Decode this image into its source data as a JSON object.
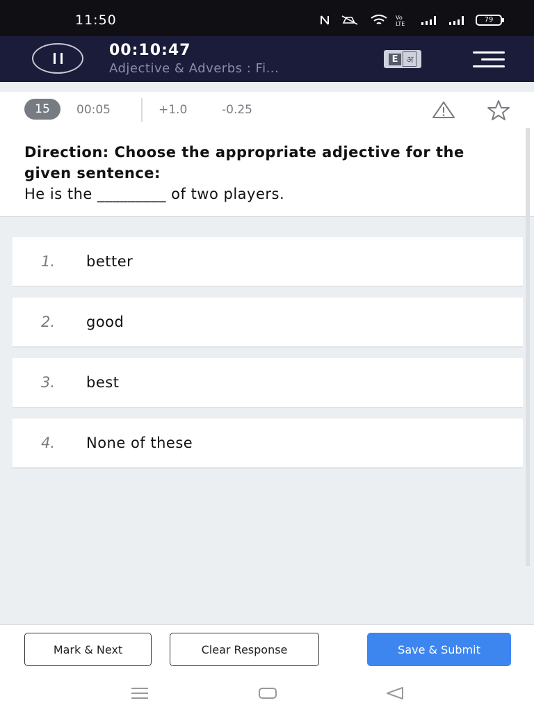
{
  "status_bar": {
    "time": "11:50",
    "battery": "79"
  },
  "header": {
    "timer": "00:10:47",
    "subtitle": "Adjective & Adverbs : Fi...",
    "lang_english": "E",
    "lang_hindi": "अ"
  },
  "meta": {
    "question_number": "15",
    "question_time": "00:05",
    "positive_marks": "+1.0",
    "negative_marks": "-0.25"
  },
  "question": {
    "direction": "Direction: Choose the appropriate adjective for the given sentence:",
    "sentence": "He is the _________ of two players."
  },
  "options": [
    {
      "number": "1.",
      "text": "better"
    },
    {
      "number": "2.",
      "text": "good"
    },
    {
      "number": "3.",
      "text": "best"
    },
    {
      "number": "4.",
      "text": "None of these"
    }
  ],
  "footer": {
    "mark_next_label": "Mark & Next",
    "clear_label": "Clear Response",
    "submit_label": "Save & Submit"
  },
  "colors": {
    "header_bg": "#1a1c3a",
    "primary": "#3d86f0",
    "badge_bg": "#777b82"
  },
  "icons": [
    "pause-icon",
    "menu-icon",
    "report-icon",
    "star-icon",
    "wifi-icon",
    "signal-icon",
    "battery-icon",
    "nav-menu-icon",
    "nav-home-icon",
    "nav-back-icon"
  ]
}
